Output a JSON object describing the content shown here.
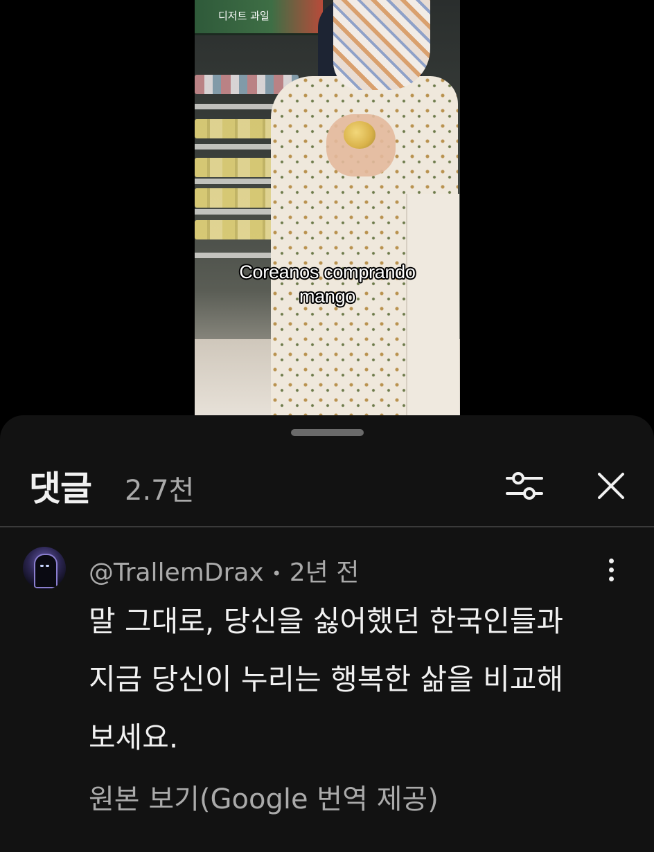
{
  "video": {
    "caption_lines": [
      "Coreanos comprando",
      "mango"
    ],
    "shelf_sign": "디저트 과일"
  },
  "comments_sheet": {
    "title": "댓글",
    "count": "2.7천",
    "filter_icon": "sliders-icon",
    "close_icon": "close-icon"
  },
  "comment": {
    "author": "@TrallemDrax",
    "separator": "•",
    "time": "2년 전",
    "text_lines": [
      "말 그대로, 당신을 싫어했던 한국인들과",
      "지금 당신이 누리는 행복한 삶을 비교해",
      "보세요."
    ],
    "translate_link": "원본 보기(Google 번역 제공)",
    "more_icon": "more-vert-icon"
  },
  "colors": {
    "sheet_bg": "#121212",
    "primary_text": "#f1f1f1",
    "secondary_text": "#aaaaaa"
  }
}
